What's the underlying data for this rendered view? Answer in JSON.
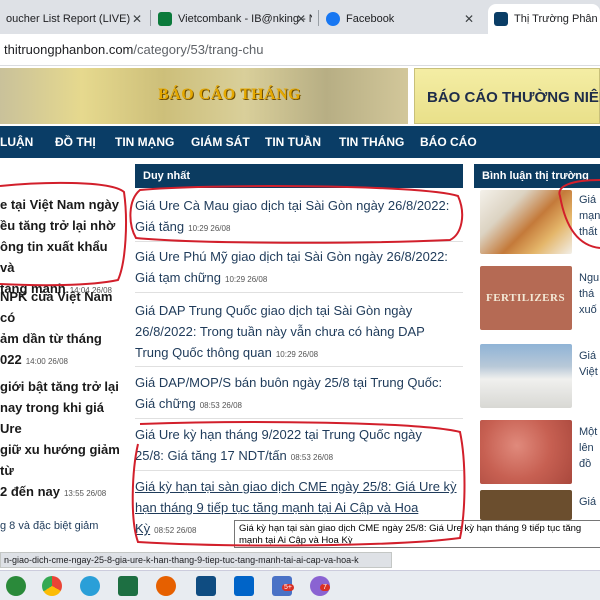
{
  "tabs": [
    {
      "label": "oucher List Report (LIVE)"
    },
    {
      "label": "Vietcombank - IB@nking - Ng"
    },
    {
      "label": "Facebook"
    },
    {
      "label": "Thị Trường Phân Bón"
    }
  ],
  "address": {
    "host": "thitruongphanbon.com",
    "path": "/category/53/trang-chu"
  },
  "banners": {
    "left": "BÁO CÁO THÁNG",
    "right": "BÁO CÁO THƯỜNG NIÊN"
  },
  "nav": [
    "LUẬN",
    "ĐỒ THỊ",
    "TIN MẠNG",
    "GIÁM SÁT",
    "TIN TUẦN",
    "TIN THÁNG",
    "BÁO CÁO"
  ],
  "left": {
    "items": [
      {
        "lines": [
          "e tại Việt Nam ngày",
          "ều tăng trở lại nhờ",
          "ông tin xuất khẩu và",
          "tăng mạnh"
        ],
        "time": "14:04 26/08"
      },
      {
        "lines": [
          "NPK của Việt Nam có",
          "ảm dần từ tháng",
          "022"
        ],
        "time": "14:00 26/08"
      },
      {
        "lines": [
          "giới bật tăng trở lại",
          "nay trong khi giá Ure",
          "giữ xu hướng giảm từ",
          "2 đến nay"
        ],
        "time": "13:55 26/08"
      }
    ],
    "bottom": "g 8 và đặc biệt giảm"
  },
  "middle": {
    "heading": "Duy nhất",
    "items": [
      {
        "lines": [
          "Giá Ure Cà Mau giao dịch tại Sài Gòn ngày 26/8/2022:",
          "Giá tăng"
        ],
        "time": "10:29 26/08"
      },
      {
        "lines": [
          "Giá Ure Phú Mỹ giao dịch tại Sài Gòn ngày 26/8/2022:",
          "Giá tạm chững"
        ],
        "time": "10:29 26/08"
      },
      {
        "lines": [
          "Giá DAP Trung Quốc giao dịch tại Sài Gòn ngày",
          "26/8/2022: Trong tuần này vẫn chưa có hàng DAP",
          "Trung Quốc thông quan"
        ],
        "time": "10:29 26/08"
      },
      {
        "lines": [
          "Giá DAP/MOP/S bán buôn ngày 25/8 tại Trung Quốc:",
          "Giá chững"
        ],
        "time": "08:53 26/08"
      },
      {
        "lines": [
          "Giá Ure kỳ hạn tháng 9/2022 tại Trung Quốc ngày",
          "25/8: Giá tăng 17 NDT/tấn"
        ],
        "time": "08:53 26/08"
      },
      {
        "lines": [
          "Giá kỳ hạn tại sàn giao dịch CME ngày 25/8: Giá Ure kỳ",
          "hạn tháng 9 tiếp tục tăng mạnh tại Ai Cập và Hoa",
          "Kỳ"
        ],
        "time": "08:52 26/08"
      }
    ]
  },
  "right": {
    "heading": "Bình luận thị trường",
    "items": [
      {
        "lines": [
          "Giá",
          "mạn",
          "thất"
        ]
      },
      {
        "lines": [
          "Ngu",
          "thá",
          "xuố"
        ],
        "thumb_text": "FERTILIZERS"
      },
      {
        "lines": [
          "Giá",
          "Việt"
        ]
      },
      {
        "lines": [
          "Một",
          "lên",
          "đồ"
        ]
      },
      {
        "lines": [
          "Giá"
        ]
      }
    ]
  },
  "tooltip": "Giá kỳ hạn tại sàn giao dịch CME ngày 25/8: Giá Ure kỳ hạn tháng 9 tiếp tục tăng mạnh tại Ai Cập và Hoa Kỳ",
  "status_url": "n-giao-dich-cme-ngay-25-8-gia-ure-k-han-thang-9-tiep-tuc-tang-manh-tai-ai-cap-va-hoa-k",
  "taskbar": {
    "badge_a": "5+",
    "badge_b": "7"
  },
  "colors": {
    "nav": "#0a3d66",
    "ink": "#d21f2b",
    "link": "#1f3b5a"
  }
}
